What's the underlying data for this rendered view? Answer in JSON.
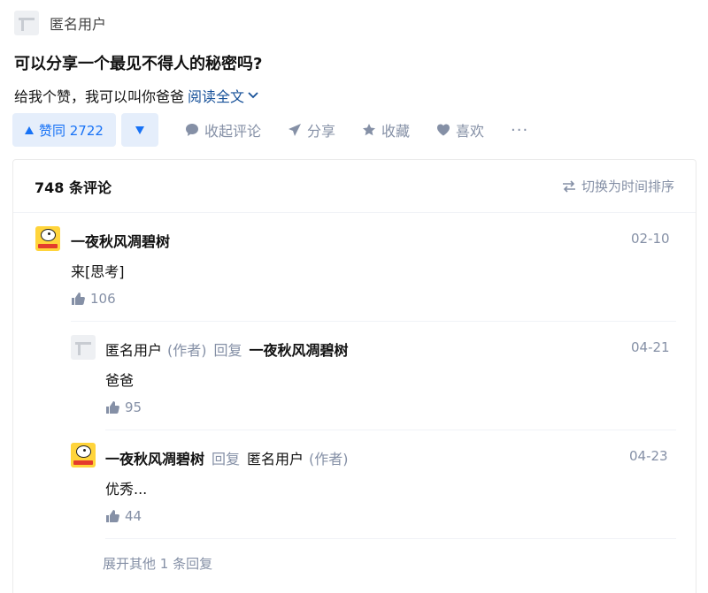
{
  "author": {
    "name": "匿名用户",
    "avatar_icon": "anonymous-avatar-icon"
  },
  "question": {
    "title": "可以分享一个最见不得人的秘密吗?"
  },
  "answer": {
    "excerpt": "给我个赞，我可以叫你爸爸",
    "read_more": "阅读全文"
  },
  "actions": {
    "vote_up_label": "赞同 2722",
    "collapse_comments": "收起评论",
    "share": "分享",
    "favorite": "收藏",
    "like": "喜欢",
    "more": "···"
  },
  "comments": {
    "count_label": "748 条评论",
    "sort_label": "切换为时间排序",
    "items": [
      {
        "user": "一夜秋风凋碧树",
        "date": "02-10",
        "text": "来[思考]",
        "likes": "106"
      },
      {
        "user": "匿名用户",
        "user_tag": "(作者)",
        "reply_word": "回复",
        "reply_to": "一夜秋风凋碧树",
        "date": "04-21",
        "text": "爸爸",
        "likes": "95"
      },
      {
        "user": "一夜秋风凋碧树",
        "reply_word": "回复",
        "reply_to": "匿名用户",
        "reply_to_tag": "(作者)",
        "date": "04-23",
        "text": "优秀...",
        "likes": "44"
      }
    ],
    "expand_label": "展开其他 1 条回复"
  },
  "colors": {
    "accent": "#1772f6",
    "accent_bg": "#e5eefb",
    "link": "#175199",
    "muted": "#8590a6"
  }
}
